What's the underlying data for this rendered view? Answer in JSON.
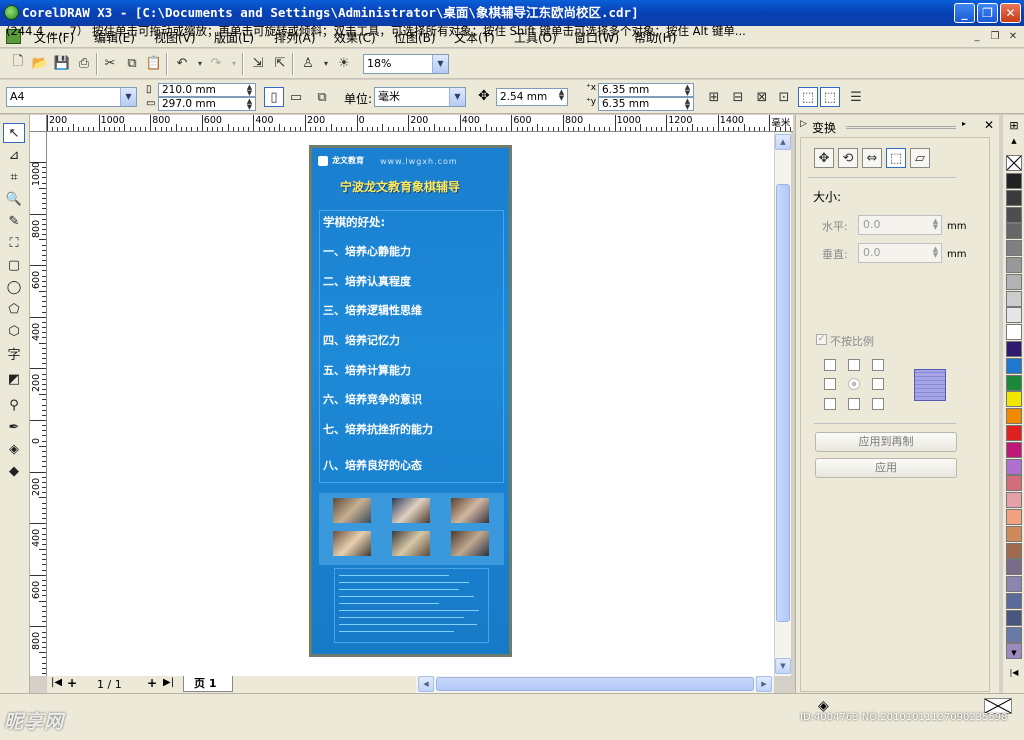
{
  "window": {
    "title": "CorelDRAW X3 - [C:\\Documents and Settings\\Administrator\\桌面\\象棋辅导江东欧尚校区.cdr]",
    "minimize": "_",
    "restore": "❐",
    "close": "✕"
  },
  "menu": {
    "items": [
      "文件(F)",
      "编辑(E)",
      "视图(V)",
      "版面(L)",
      "排列(A)",
      "效果(C)",
      "位图(B)",
      "文本(T)",
      "工具(O)",
      "窗口(W)",
      "帮助(H)"
    ],
    "mdi": [
      "_",
      "❐",
      "✕"
    ]
  },
  "toolbar1": {
    "zoom": "18%"
  },
  "toolbar2": {
    "paper_size": "A4",
    "width": "210.0 mm",
    "height": "297.0 mm",
    "units_label": "单位:",
    "units": "毫米",
    "nudge": "2.54 mm",
    "dup_x": "6.35 mm",
    "dup_y": "6.35 mm"
  },
  "ruler": {
    "h_labels": [
      "200",
      "1000",
      "800",
      "600",
      "400",
      "200",
      "0",
      "200",
      "400",
      "600",
      "800",
      "1000",
      "1200",
      "1400",
      "毫米"
    ],
    "v_labels": [
      "1000",
      "800",
      "600",
      "400",
      "200",
      "0",
      "200",
      "400",
      "600",
      "800"
    ]
  },
  "poster": {
    "logo": "龙文教育",
    "url": "www.lwgxh.com",
    "title": "宁波龙文教育象棋辅导",
    "heading": "学棋的好处:",
    "benefits": [
      "一、培养心静能力",
      "二、培养认真程度",
      "三、培养逻辑性思维",
      "四、培养记忆力",
      "五、培养计算能力",
      "六、培养竞争的意识",
      "七、培养抗挫折的能力",
      "八、培养良好的心态"
    ]
  },
  "pagenav": {
    "counter": "1 / 1",
    "tab": "页 1"
  },
  "docker": {
    "title": "变换",
    "size_label": "大小:",
    "h_label": "水平:",
    "h_value": "0.0",
    "v_label": "垂直:",
    "v_value": "0.0",
    "unit": "mm",
    "proportional": "不按比例",
    "apply_dup": "应用到再制",
    "apply": "应用"
  },
  "palette": {
    "colors": [
      "#222222",
      "#3a3a3a",
      "#4e4e4e",
      "#666666",
      "#808080",
      "#999999",
      "#b3b3b3",
      "#cccccc",
      "#e6e6e6",
      "#ffffff",
      "#2e1a6e",
      "#1f77d0",
      "#1a8a3a",
      "#f2e600",
      "#f28a00",
      "#e02020",
      "#c01878",
      "#b070d0",
      "#d36d7c",
      "#e6a0a8",
      "#f2a080",
      "#d08a5a",
      "#a06a50",
      "#7a6a8a",
      "#8a84b0",
      "#5a6a9a",
      "#4a5680",
      "#6a7aa8",
      "#9a8ac0"
    ]
  },
  "status": {
    "text": "(244.4 ...，7）  按住单击可拖动或缩放；再单击可旋转或倾斜；双击工具，可选择所有对象；按住 Shift 键单击可选择多个对象；按住 Alt 键单..."
  },
  "watermark": {
    "brand": "昵享网",
    "id": "ID:4004763 NO:20101011127090235598"
  }
}
